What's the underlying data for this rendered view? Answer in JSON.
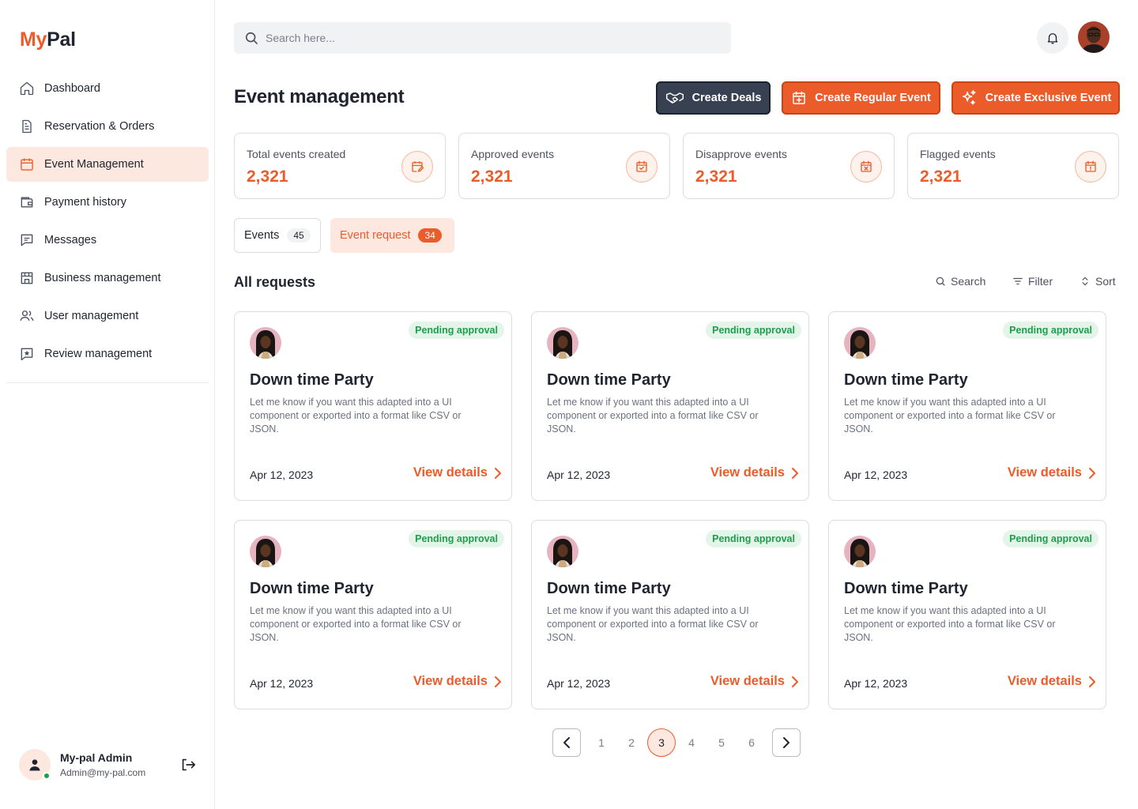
{
  "brand": {
    "name_part1": "My",
    "name_part2": "Pal"
  },
  "sidebar": {
    "items": [
      {
        "label": "Dashboard",
        "icon": "home-icon"
      },
      {
        "label": "Reservation & Orders",
        "icon": "document-icon"
      },
      {
        "label": "Event Management",
        "icon": "calendar-icon",
        "active": true
      },
      {
        "label": "Payment history",
        "icon": "wallet-icon"
      },
      {
        "label": "Messages",
        "icon": "chat-icon"
      },
      {
        "label": "Business management",
        "icon": "store-icon"
      },
      {
        "label": "User management",
        "icon": "users-icon"
      },
      {
        "label": "Review management",
        "icon": "review-icon"
      }
    ],
    "profile": {
      "name": "My-pal Admin",
      "email": "Admin@my-pal.com",
      "status": "online"
    }
  },
  "topbar": {
    "search_placeholder": "Search here..."
  },
  "header": {
    "title": "Event management",
    "buttons": {
      "create_deals": "Create Deals",
      "create_regular": "Create Regular Event",
      "create_exclusive": "Create Exclusive Event"
    }
  },
  "stats": [
    {
      "label": "Total events created",
      "value": "2,321",
      "icon": "calendar-edit-icon"
    },
    {
      "label": "Approved events",
      "value": "2,321",
      "icon": "calendar-check-icon"
    },
    {
      "label": "Disapprove events",
      "value": "2,321",
      "icon": "calendar-x-icon"
    },
    {
      "label": "Flagged events",
      "value": "2,321",
      "icon": "calendar-alert-icon"
    }
  ],
  "tabs": [
    {
      "label": "Events",
      "count": "45",
      "active": false
    },
    {
      "label": "Event request",
      "count": "34",
      "active": true
    }
  ],
  "list": {
    "title": "All requests",
    "tools": {
      "search": "Search",
      "filter": "Filter",
      "sort": "Sort"
    }
  },
  "cards": [
    {
      "status": "Pending approval",
      "title": "Down time Party",
      "description": "Let me know if you want this adapted into a UI component or exported into a format like CSV or JSON.",
      "date": "Apr 12, 2023",
      "link": "View details"
    },
    {
      "status": "Pending approval",
      "title": "Down time Party",
      "description": "Let me know if you want this adapted into a UI component or exported into a format like CSV or JSON.",
      "date": "Apr 12, 2023",
      "link": "View details"
    },
    {
      "status": "Pending approval",
      "title": "Down time Party",
      "description": "Let me know if you want this adapted into a UI component or exported into a format like CSV or JSON.",
      "date": "Apr 12, 2023",
      "link": "View details"
    },
    {
      "status": "Pending approval",
      "title": "Down time Party",
      "description": "Let me know if you want this adapted into a UI component or exported into a format like CSV or JSON.",
      "date": "Apr 12, 2023",
      "link": "View details"
    },
    {
      "status": "Pending approval",
      "title": "Down time Party",
      "description": "Let me know if you want this adapted into a UI component or exported into a format like CSV or JSON.",
      "date": "Apr 12, 2023",
      "link": "View details"
    },
    {
      "status": "Pending approval",
      "title": "Down time Party",
      "description": "Let me know if you want this adapted into a UI component or exported into a format like CSV or JSON.",
      "date": "Apr 12, 2023",
      "link": "View details"
    }
  ],
  "pagination": {
    "pages": [
      "1",
      "2",
      "3",
      "4",
      "5",
      "6"
    ],
    "current": "3"
  },
  "colors": {
    "accent": "#ec5b2a",
    "accent_light": "#fde8df",
    "dark_button": "#384151",
    "success": "#1f9d4c",
    "success_bg": "#e3f5e9"
  }
}
